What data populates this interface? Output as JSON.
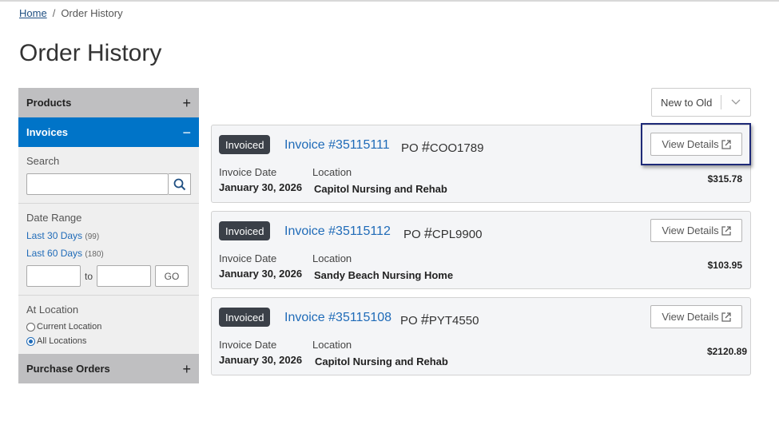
{
  "breadcrumb": {
    "home": "Home",
    "separator": "/",
    "current": "Order History"
  },
  "page_title": "Order History",
  "sidebar": {
    "products": {
      "label": "Products",
      "symbol": "+"
    },
    "invoices": {
      "label": "Invoices",
      "symbol": "−",
      "search_label": "Search",
      "date_range_label": "Date Range",
      "last30": {
        "label": "Last 30 Days",
        "count": "(99)"
      },
      "last60": {
        "label": "Last 60 Days",
        "count": "(180)"
      },
      "to_label": "to",
      "go_label": "GO",
      "location_label": "At Location",
      "current_location": "Current Location",
      "all_locations": "All Locations",
      "selected_location": "All Locations"
    },
    "purchase_orders": {
      "label": "Purchase Orders",
      "symbol": "+"
    }
  },
  "sort": {
    "selected": "New to Old"
  },
  "invoices": [
    {
      "status": "Invoiced",
      "title": "Invoice #35115111",
      "po_prefix": "PO",
      "po_hash": "#",
      "po_number": "COO1789",
      "view_label": "View Details",
      "date_label": "Invoice Date",
      "date": "January 30, 2026",
      "location_label": "Location",
      "location": "Capitol Nursing and Rehab",
      "amount": "$315.78"
    },
    {
      "status": "Invoiced",
      "title": "Invoice #35115112",
      "po_prefix": "PO",
      "po_hash": "#",
      "po_number": "CPL9900",
      "view_label": "View Details",
      "date_label": "Invoice Date",
      "date": "January 30, 2026",
      "location_label": "Location",
      "location": "Sandy Beach Nursing Home",
      "amount": "$103.95"
    },
    {
      "status": "Invoiced",
      "title": "Invoice #35115108",
      "po_prefix": "PO",
      "po_hash": "#",
      "po_number": "PYT4550",
      "view_label": "View Details",
      "date_label": "Invoice Date",
      "date": "January 30, 2026",
      "location_label": "Location",
      "location": "Capitol Nursing and Rehab",
      "amount": "$2120.89"
    }
  ],
  "colors": {
    "accent_blue": "#0074c8",
    "link_blue": "#1f6bb8",
    "badge_dark": "#3b4048",
    "focus_ring": "#1e2a78"
  },
  "icons": {
    "search": "search-icon",
    "external": "external-link-icon",
    "chevron": "chevron-down-icon"
  }
}
